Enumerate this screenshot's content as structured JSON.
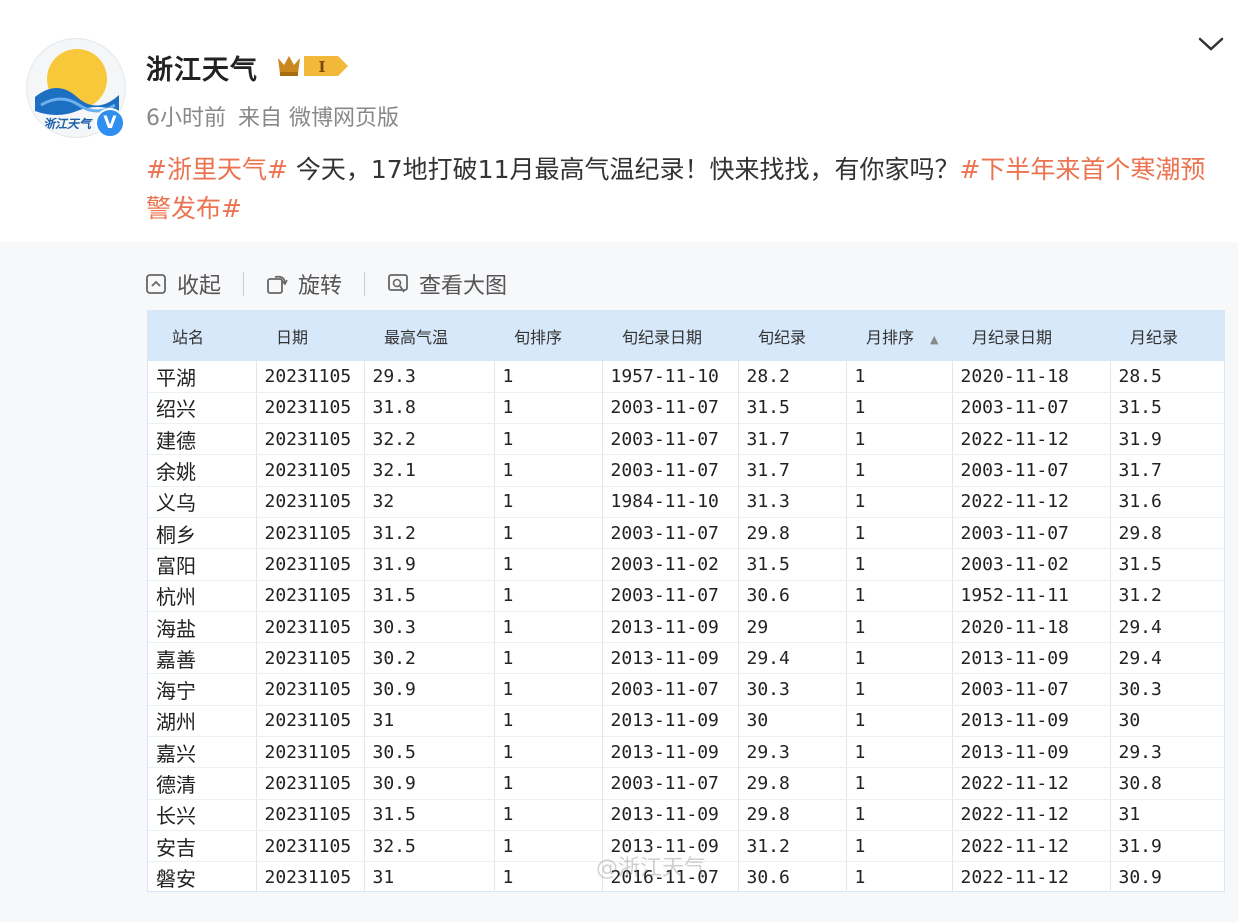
{
  "post": {
    "username": "浙江天气",
    "avatar_text": "浙江天气",
    "badge_label": "I",
    "time": "6小时前",
    "source": "来自 微博网页版",
    "tag1": "#浙里天气#",
    "body": " 今天，17地打破11月最高气温纪录！快来找找，有你家吗？",
    "tag2": "#下半年来首个寒潮预警发布#"
  },
  "toolbar": {
    "collapse": "收起",
    "rotate": "旋转",
    "view_large": "查看大图"
  },
  "watermark": "@浙江天气",
  "table": {
    "headers": [
      "站名",
      "日期",
      "最高气温",
      "旬排序",
      "旬纪录日期",
      "旬纪录",
      "月排序",
      "月纪录日期",
      "月纪录"
    ],
    "rows": [
      [
        "平湖",
        "20231105",
        "29.3",
        "1",
        "1957-11-10",
        "28.2",
        "1",
        "2020-11-18",
        "28.5"
      ],
      [
        "绍兴",
        "20231105",
        "31.8",
        "1",
        "2003-11-07",
        "31.5",
        "1",
        "2003-11-07",
        "31.5"
      ],
      [
        "建德",
        "20231105",
        "32.2",
        "1",
        "2003-11-07",
        "31.7",
        "1",
        "2022-11-12",
        "31.9"
      ],
      [
        "余姚",
        "20231105",
        "32.1",
        "1",
        "2003-11-07",
        "31.7",
        "1",
        "2003-11-07",
        "31.7"
      ],
      [
        "义乌",
        "20231105",
        "32",
        "1",
        "1984-11-10",
        "31.3",
        "1",
        "2022-11-12",
        "31.6"
      ],
      [
        "桐乡",
        "20231105",
        "31.2",
        "1",
        "2003-11-07",
        "29.8",
        "1",
        "2003-11-07",
        "29.8"
      ],
      [
        "富阳",
        "20231105",
        "31.9",
        "1",
        "2003-11-02",
        "31.5",
        "1",
        "2003-11-02",
        "31.5"
      ],
      [
        "杭州",
        "20231105",
        "31.5",
        "1",
        "2003-11-07",
        "30.6",
        "1",
        "1952-11-11",
        "31.2"
      ],
      [
        "海盐",
        "20231105",
        "30.3",
        "1",
        "2013-11-09",
        "29",
        "1",
        "2020-11-18",
        "29.4"
      ],
      [
        "嘉善",
        "20231105",
        "30.2",
        "1",
        "2013-11-09",
        "29.4",
        "1",
        "2013-11-09",
        "29.4"
      ],
      [
        "海宁",
        "20231105",
        "30.9",
        "1",
        "2003-11-07",
        "30.3",
        "1",
        "2003-11-07",
        "30.3"
      ],
      [
        "湖州",
        "20231105",
        "31",
        "1",
        "2013-11-09",
        "30",
        "1",
        "2013-11-09",
        "30"
      ],
      [
        "嘉兴",
        "20231105",
        "30.5",
        "1",
        "2013-11-09",
        "29.3",
        "1",
        "2013-11-09",
        "29.3"
      ],
      [
        "德清",
        "20231105",
        "30.9",
        "1",
        "2003-11-07",
        "29.8",
        "1",
        "2022-11-12",
        "30.8"
      ],
      [
        "长兴",
        "20231105",
        "31.5",
        "1",
        "2013-11-09",
        "29.8",
        "1",
        "2022-11-12",
        "31"
      ],
      [
        "安吉",
        "20231105",
        "32.5",
        "1",
        "2013-11-09",
        "31.2",
        "1",
        "2022-11-12",
        "31.9"
      ],
      [
        "磐安",
        "20231105",
        "31",
        "1",
        "2016-11-07",
        "30.6",
        "1",
        "2022-11-12",
        "30.9"
      ]
    ]
  },
  "colors": {
    "tag": "#eb7350",
    "header_bg": "#d7e8fa",
    "verified": "#2f8ff0"
  },
  "icons": {
    "more": "chevron-down-icon",
    "collapse": "collapse-icon",
    "rotate": "rotate-icon",
    "view": "view-large-icon"
  }
}
